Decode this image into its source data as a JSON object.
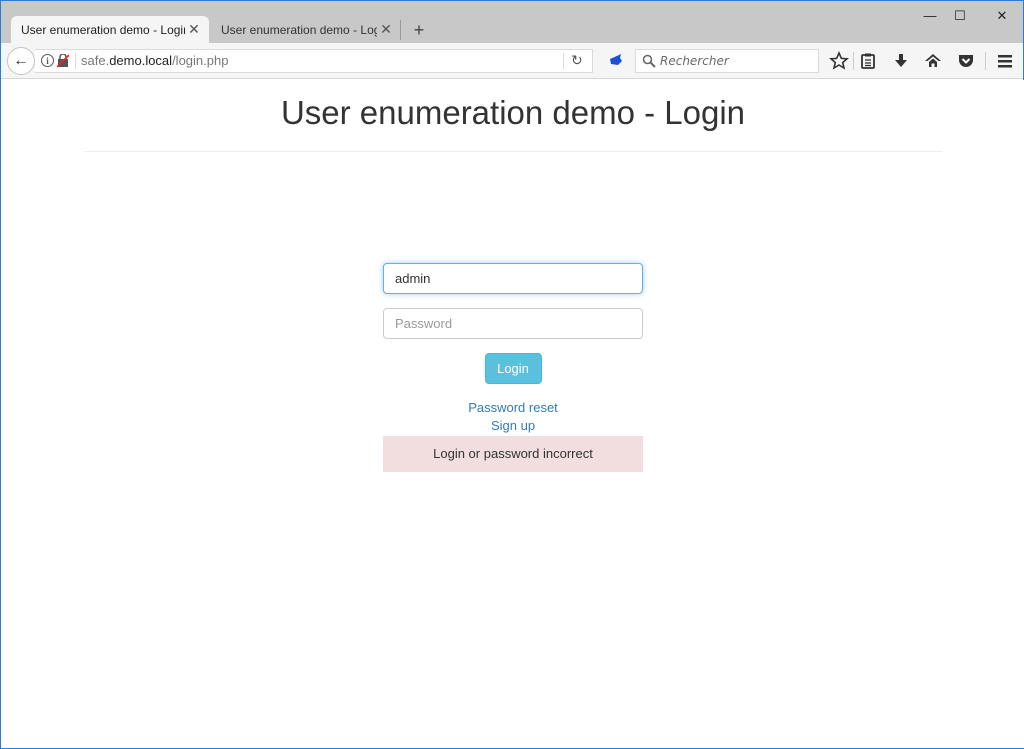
{
  "browser": {
    "tabs": [
      {
        "title": "User enumeration demo - Login",
        "active": true
      },
      {
        "title": "User enumeration demo - Login",
        "active": false
      }
    ],
    "new_tab_label": "+",
    "window_controls": {
      "minimize": "—",
      "maximize": "☐",
      "close": "✕"
    },
    "url": {
      "prefix": "safe.",
      "host": "demo.local",
      "path": "/login.php"
    },
    "search": {
      "placeholder": "Rechercher",
      "value": ""
    },
    "icons": [
      "back-icon",
      "info-icon",
      "insecure-lock-icon",
      "reload-icon",
      "extension-icon",
      "search-icon",
      "bookmark-star-icon",
      "reading-list-icon",
      "download-icon",
      "home-icon",
      "pocket-icon",
      "menu-icon"
    ]
  },
  "page": {
    "title": "User enumeration demo - Login",
    "form": {
      "username_value": "admin",
      "password_placeholder": "Password",
      "password_value": "",
      "login_label": "Login"
    },
    "links": {
      "password_reset": "Password reset",
      "sign_up": "Sign up"
    },
    "alert": {
      "message": "Login or password incorrect",
      "color": "#f2dede"
    },
    "colors": {
      "button": "#5bc0de",
      "link": "#337ab7",
      "focus": "#66afe9"
    }
  }
}
